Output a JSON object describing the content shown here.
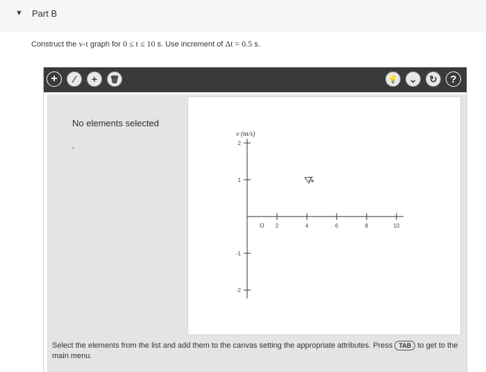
{
  "part": {
    "toggle_icon": "▼",
    "title": "Part B"
  },
  "instruction": {
    "prefix": "Construct the ",
    "vt": "v-t",
    "middle": " graph for ",
    "range": "0 ≤ t ≤ 10",
    "unit1": " s. Use increment of ",
    "increment": "Δt = 0.5",
    "unit2": " s."
  },
  "toolbar": {
    "add": "+",
    "edit": "⁄",
    "add_point": "+",
    "delete": "🗑",
    "hint": "💡",
    "more": "⌄",
    "reset": "↻",
    "help": "?"
  },
  "panel": {
    "status": "No elements selected",
    "marker": "•"
  },
  "graph": {
    "y_axis_label": "v (m/s)",
    "origin_label": "O",
    "x_ticks": [
      "2",
      "4",
      "6",
      "8",
      "10"
    ],
    "y_ticks_positive": [
      "2",
      "1"
    ],
    "y_ticks_negative": [
      "-1",
      "-2"
    ],
    "cursor_icon": "pointer-cursor-icon"
  },
  "footer": {
    "before_key": "Select the elements from the list and add them to the canvas setting the appropriate attributes. Press ",
    "key": "TAB",
    "after_key": " to get to the main menu."
  },
  "colors": {
    "toolbar": "#3a3a3a",
    "panel": "#e4e4e4",
    "canvas": "#ffffff"
  }
}
